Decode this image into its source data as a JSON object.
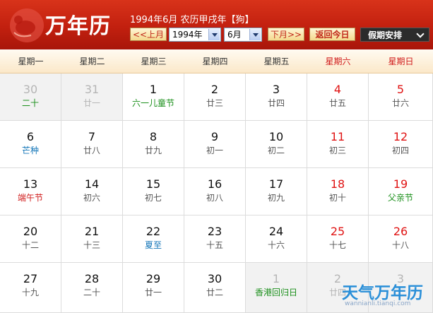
{
  "header": {
    "logo_text": "万年历",
    "info": "1994年6月 农历甲戌年【狗】",
    "prev_month": "<<上月",
    "year_value": "1994年",
    "month_value": "6月",
    "next_month": "下月>>",
    "today": "返回今日",
    "holiday": "假期安排"
  },
  "weekdays": [
    "星期一",
    "星期二",
    "星期三",
    "星期四",
    "星期五",
    "星期六",
    "星期日"
  ],
  "weeks": [
    [
      {
        "d": "30",
        "l": "二十",
        "other": true,
        "lc": "festival"
      },
      {
        "d": "31",
        "l": "廿一",
        "other": true
      },
      {
        "d": "1",
        "l": "六一儿童节",
        "lc": "festival"
      },
      {
        "d": "2",
        "l": "廿三"
      },
      {
        "d": "3",
        "l": "廿四"
      },
      {
        "d": "4",
        "l": "廿五",
        "red": true
      },
      {
        "d": "5",
        "l": "廿六",
        "red": true
      }
    ],
    [
      {
        "d": "6",
        "l": "芒种",
        "lc": "term"
      },
      {
        "d": "7",
        "l": "廿八"
      },
      {
        "d": "8",
        "l": "廿九"
      },
      {
        "d": "9",
        "l": "初一"
      },
      {
        "d": "10",
        "l": "初二"
      },
      {
        "d": "11",
        "l": "初三",
        "red": true
      },
      {
        "d": "12",
        "l": "初四",
        "red": true
      }
    ],
    [
      {
        "d": "13",
        "l": "端午节",
        "lc": "redtext"
      },
      {
        "d": "14",
        "l": "初六"
      },
      {
        "d": "15",
        "l": "初七"
      },
      {
        "d": "16",
        "l": "初八"
      },
      {
        "d": "17",
        "l": "初九"
      },
      {
        "d": "18",
        "l": "初十",
        "red": true
      },
      {
        "d": "19",
        "l": "父亲节",
        "red": true,
        "lc": "festival"
      }
    ],
    [
      {
        "d": "20",
        "l": "十二"
      },
      {
        "d": "21",
        "l": "十三"
      },
      {
        "d": "22",
        "l": "夏至",
        "lc": "term"
      },
      {
        "d": "23",
        "l": "十五"
      },
      {
        "d": "24",
        "l": "十六"
      },
      {
        "d": "25",
        "l": "十七",
        "red": true
      },
      {
        "d": "26",
        "l": "十八",
        "red": true
      }
    ],
    [
      {
        "d": "27",
        "l": "十九"
      },
      {
        "d": "28",
        "l": "二十"
      },
      {
        "d": "29",
        "l": "廿一"
      },
      {
        "d": "30",
        "l": "廿二"
      },
      {
        "d": "1",
        "l": "香港回归日",
        "other": true,
        "lc": "festival"
      },
      {
        "d": "2",
        "l": "廿四",
        "other": true
      },
      {
        "d": "3",
        "l": "",
        "other": true
      }
    ]
  ],
  "watermark": {
    "title": "天气万年历",
    "url": "wannianli.tianqi.com"
  },
  "colors": {
    "header_red": "#c2200f",
    "weekend_red": "#e01414",
    "festival_green": "#1a8f1a",
    "term_blue": "#1476b8"
  }
}
